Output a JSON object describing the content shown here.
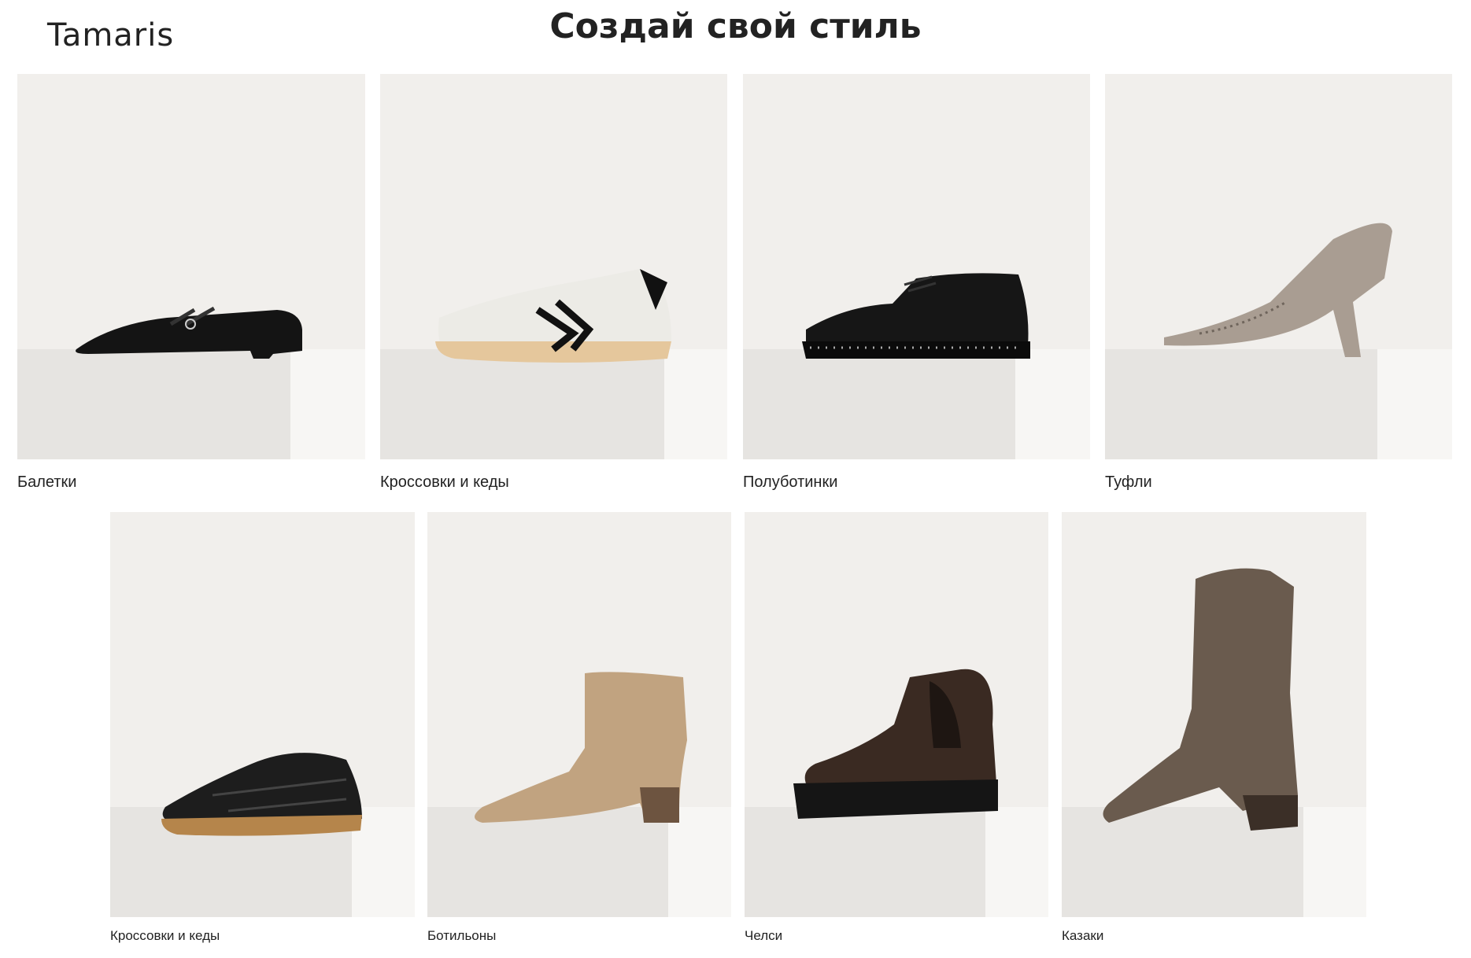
{
  "header": {
    "logo": "Tamaris",
    "title": "Создай свой стиль"
  },
  "row1": [
    {
      "label": "Балетки",
      "icon": "ballet-flat-shoe"
    },
    {
      "label": "Кроссовки и кеды",
      "icon": "sneaker-white-shoe"
    },
    {
      "label": "Полуботинки",
      "icon": "derby-shoe"
    },
    {
      "label": "Туфли",
      "icon": "pump-heel-shoe"
    }
  ],
  "row2": [
    {
      "label": "Кроссовки и кеды",
      "icon": "sneaker-black-shoe"
    },
    {
      "label": "Ботильоны",
      "icon": "ankle-boot"
    },
    {
      "label": "Челси",
      "icon": "chelsea-boot"
    },
    {
      "label": "Казаки",
      "icon": "cowboy-boot"
    }
  ],
  "colors": {
    "background": "#ffffff",
    "card_bg": "#f1efec",
    "plinth": "#e6e4e1",
    "text": "#222222"
  }
}
